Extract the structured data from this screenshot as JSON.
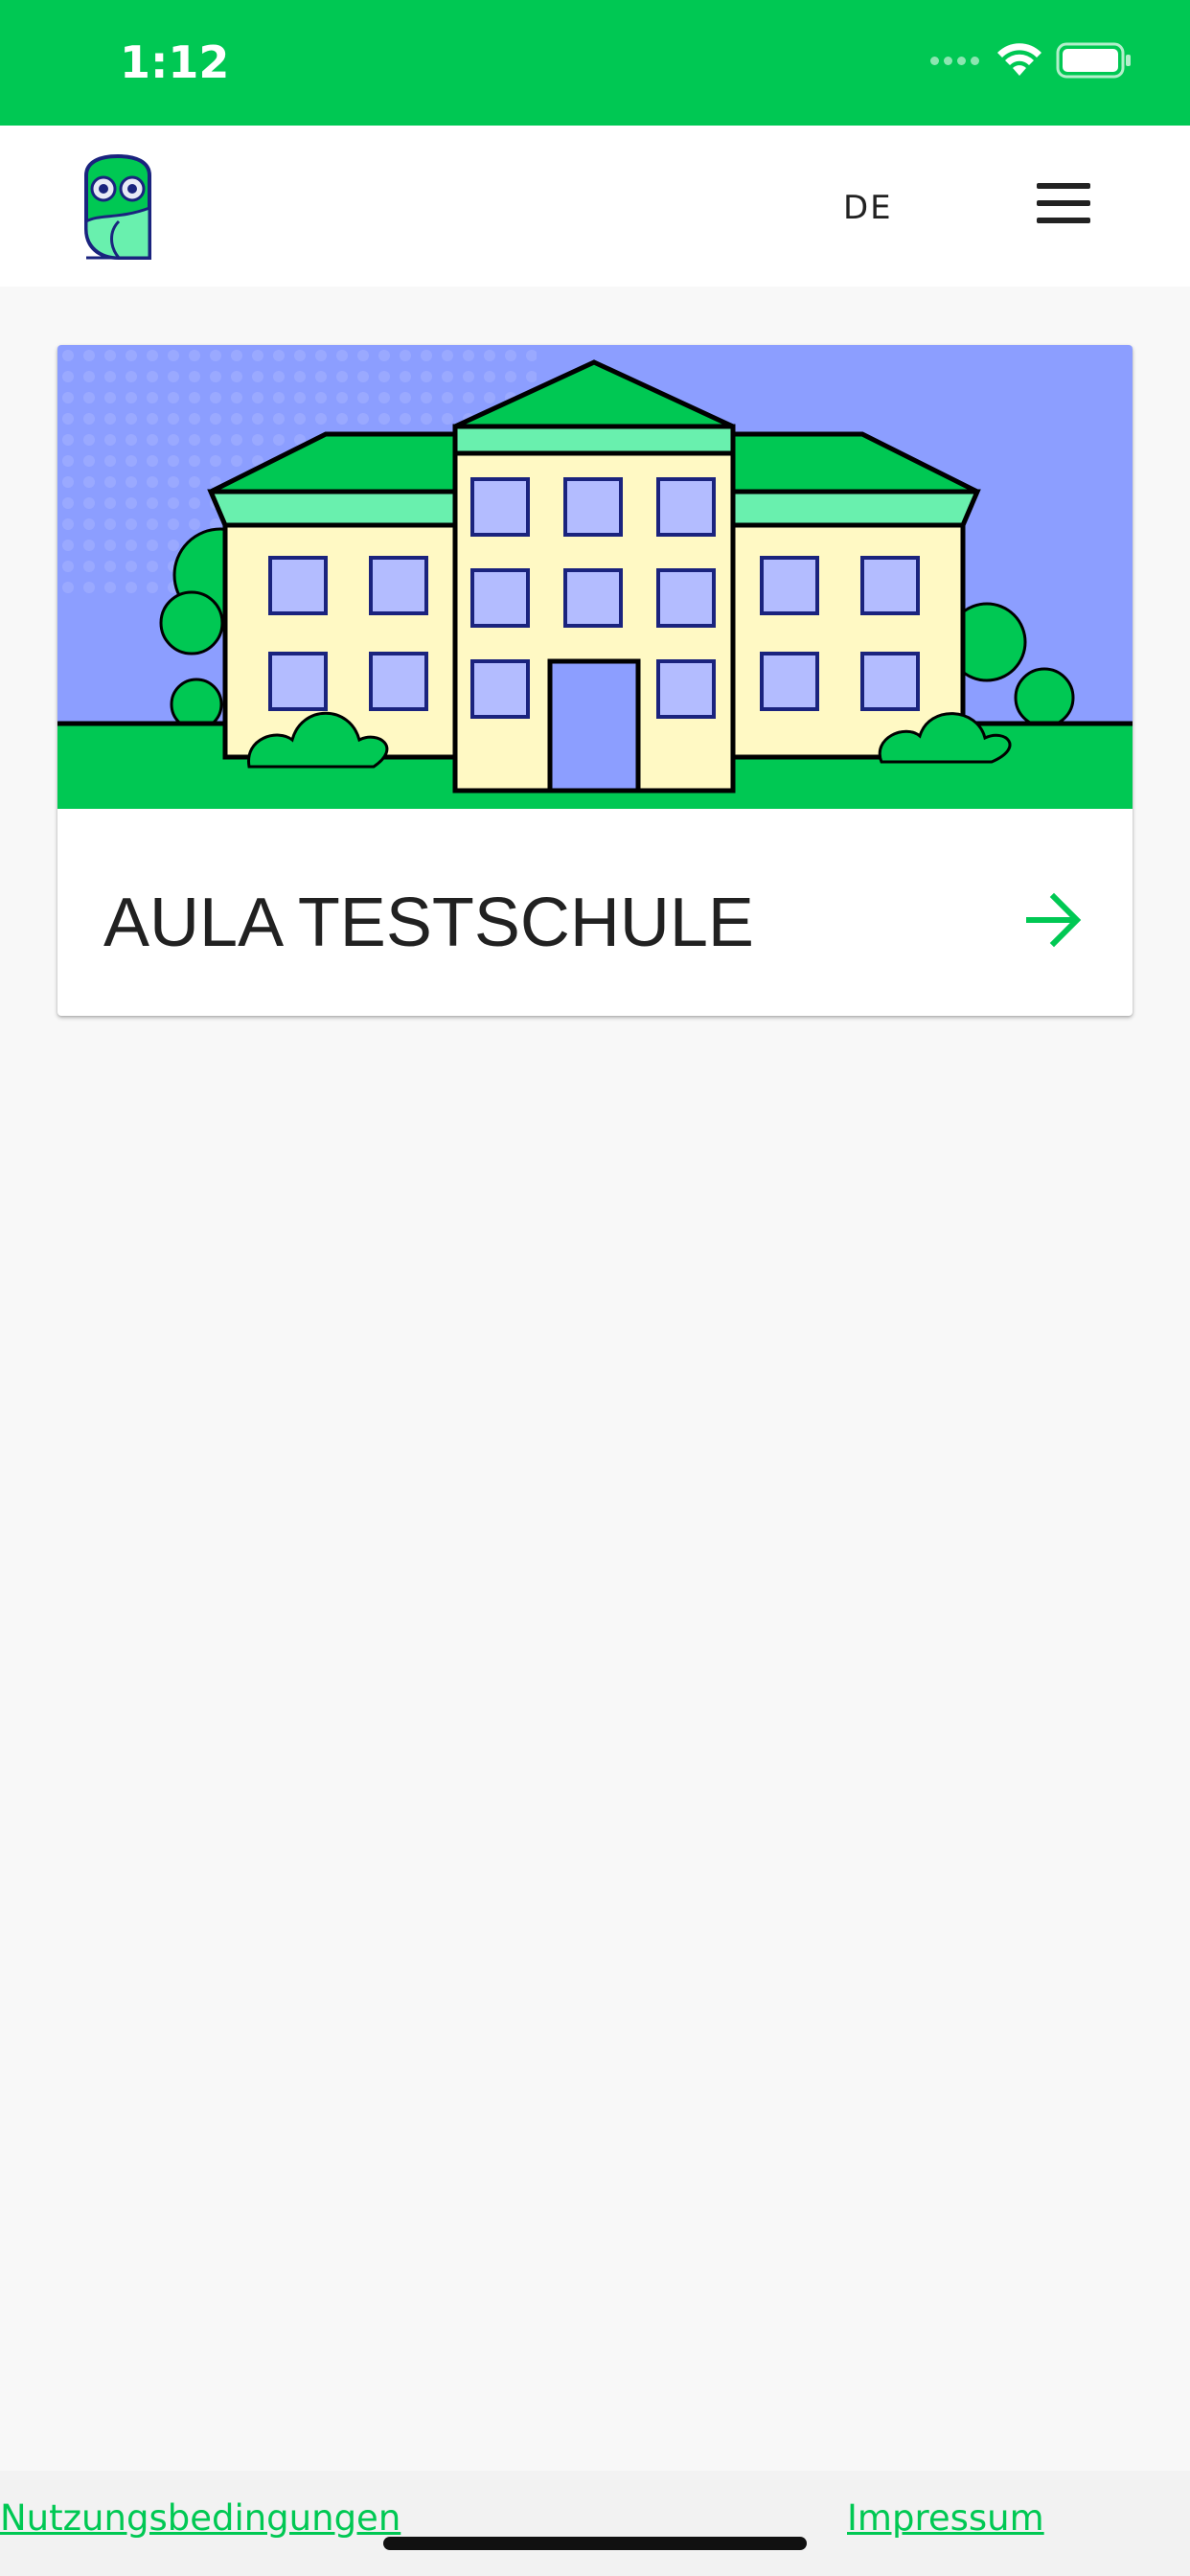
{
  "status_bar": {
    "time": "1:12",
    "icons": [
      "signal-icon",
      "wifi-icon",
      "battery-icon"
    ]
  },
  "header": {
    "logo_icon": "owl-logo-icon",
    "language_label": "DE",
    "menu_icon": "hamburger-menu-icon"
  },
  "school_card": {
    "title": "AULA TESTSCHULE",
    "image_icon": "school-building-illustration",
    "arrow_icon": "arrow-right-icon"
  },
  "footer": {
    "terms_label": "Nutzungsbedingungen",
    "imprint_label": "Impressum"
  },
  "colors": {
    "brand_green": "#00c853",
    "illustration_sky": "#8c9eff",
    "building_wall": "#fff9c4",
    "roof_light": "#69f0ae",
    "text_dark": "#212121"
  }
}
